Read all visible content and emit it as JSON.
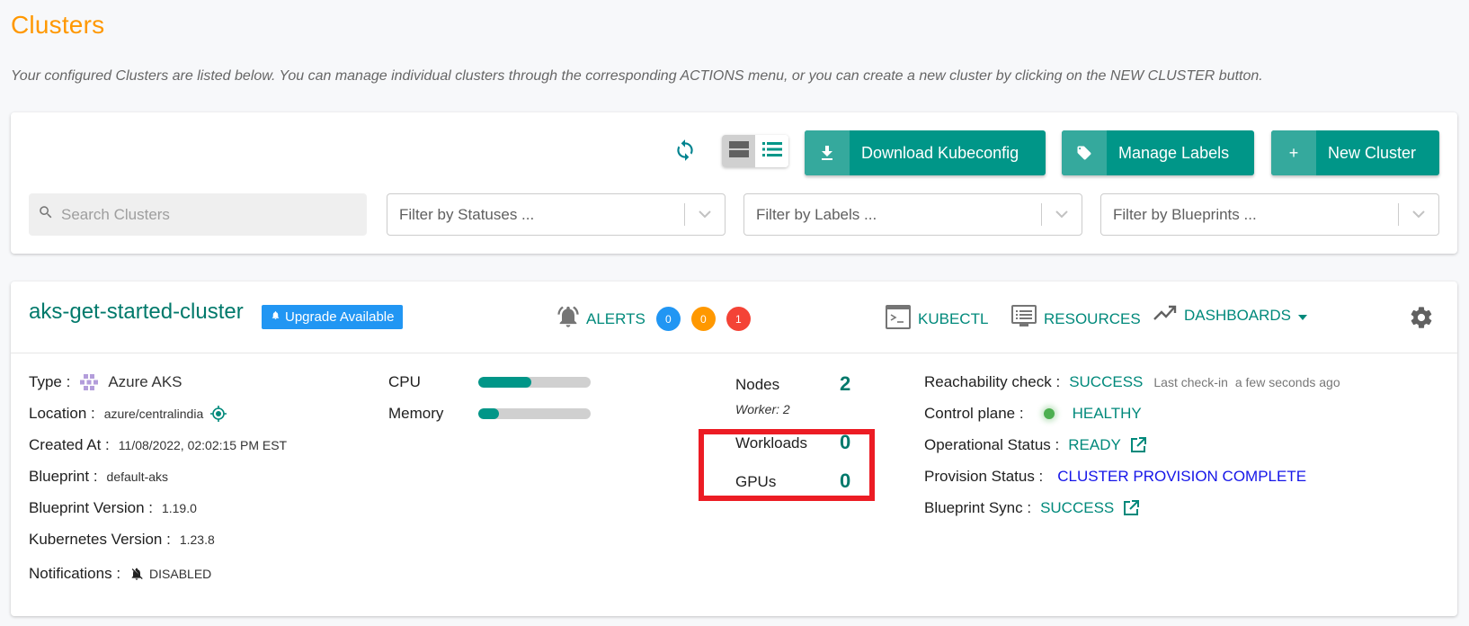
{
  "page": {
    "title": "Clusters",
    "description": "Your configured Clusters are listed below. You can manage individual clusters through the corresponding ACTIONS menu, or you can create a new cluster by clicking on the NEW CLUSTER button."
  },
  "toolbar": {
    "refresh_icon": "refresh-icon",
    "view_modes": [
      {
        "name": "card-view",
        "icon": "card-view-icon",
        "active": true
      },
      {
        "name": "list-view",
        "icon": "list-view-icon",
        "active": false
      }
    ],
    "buttons": {
      "download": {
        "label": "Download Kubeconfig",
        "icon": "download-icon"
      },
      "labels": {
        "label": "Manage Labels",
        "icon": "tag-icon"
      },
      "new_cluster": {
        "label": "New Cluster",
        "icon": "plus-icon",
        "icon_glyph": "+"
      }
    },
    "search": {
      "placeholder": "Search Clusters",
      "value": ""
    },
    "filters": {
      "statuses": {
        "placeholder": "Filter by Statuses ..."
      },
      "labels": {
        "placeholder": "Filter by Labels ..."
      },
      "blueprints": {
        "placeholder": "Filter by Blueprints ..."
      }
    }
  },
  "cluster": {
    "name": "aks-get-started-cluster",
    "upgrade_badge": "Upgrade Available",
    "alerts": {
      "label": "ALERTS",
      "counts": [
        {
          "value": "0",
          "color": "#2196f3"
        },
        {
          "value": "0",
          "color": "#ff9800"
        },
        {
          "value": "1",
          "color": "#f44336"
        }
      ]
    },
    "actions": {
      "kubectl": "KUBECTL",
      "resources": "RESOURCES",
      "dashboards": "DASHBOARDS"
    },
    "details": {
      "type": {
        "label": "Type :",
        "value": "Azure AKS"
      },
      "location": {
        "label": "Location :",
        "value": "azure/centralindia"
      },
      "created_at": {
        "label": "Created At :",
        "value": "11/08/2022, 02:02:15 PM EST"
      },
      "blueprint": {
        "label": "Blueprint :",
        "value": "default-aks"
      },
      "blueprint_version": {
        "label": "Blueprint Version :",
        "value": "1.19.0"
      },
      "kubernetes_version": {
        "label": "Kubernetes Version :",
        "value": "1.23.8"
      },
      "notifications": {
        "label": "Notifications :",
        "value": "DISABLED"
      }
    },
    "usage": {
      "cpu": {
        "label": "CPU",
        "fraction": 0.47
      },
      "memory": {
        "label": "Memory",
        "fraction": 0.18
      }
    },
    "stats": {
      "nodes": {
        "label": "Nodes",
        "value": "2",
        "sub": "Worker: 2"
      },
      "workloads": {
        "label": "Workloads",
        "value": "0"
      },
      "gpus": {
        "label": "GPUs",
        "value": "0"
      }
    },
    "status": {
      "reachability": {
        "label": "Reachability check :",
        "value": "SUCCESS",
        "last_checkin_label": "Last check-in",
        "last_checkin": "a few seconds ago"
      },
      "control_plane": {
        "label": "Control plane :",
        "value": "HEALTHY"
      },
      "operational": {
        "label": "Operational Status :",
        "value": "READY"
      },
      "provision": {
        "label": "Provision Status :",
        "value": "CLUSTER PROVISION COMPLETE"
      },
      "blueprint_sync": {
        "label": "Blueprint Sync :",
        "value": "SUCCESS"
      }
    }
  },
  "colors": {
    "accent": "#009688",
    "title": "#ff9800",
    "link": "#00897b",
    "highlight_box": "#ec1c24",
    "provision_blue": "#1515e8"
  }
}
